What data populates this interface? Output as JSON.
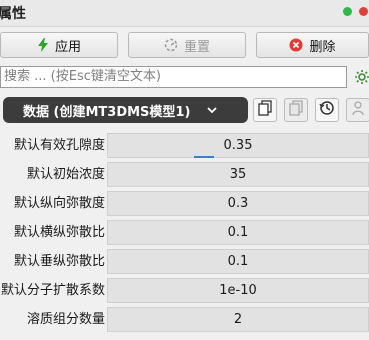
{
  "titlebar": {
    "title": "属性"
  },
  "actions": {
    "apply": "应用",
    "reset": "重置",
    "delete": "删除"
  },
  "search": {
    "placeholder": "搜索 ... (按Esc键清空文本)"
  },
  "dataset": {
    "selected": "数据 (创建MT3DMS模型1)"
  },
  "properties": [
    {
      "label": "默认有效孔隙度",
      "value": "0.35"
    },
    {
      "label": "默认初始浓度",
      "value": "35"
    },
    {
      "label": "默认纵向弥散度",
      "value": "0.3"
    },
    {
      "label": "默认横纵弥散比",
      "value": "0.1"
    },
    {
      "label": "默认垂纵弥散比",
      "value": "0.1"
    },
    {
      "label": "默认分子扩散系数",
      "value": "1e-10"
    },
    {
      "label": "溶质组分数量",
      "value": "2"
    }
  ],
  "colors": {
    "apply_icon": "#2aa52e",
    "delete_icon": "#e53935",
    "dropdown_bg": "#3c3c3c",
    "green_dot": "#2fb84a",
    "red_dot": "#e0403a"
  },
  "icons": [
    "bolt-icon",
    "reset-icon",
    "delete-icon",
    "gear-icon",
    "chevron-down-icon",
    "copy-icon",
    "paste-icon",
    "history-icon",
    "user-icon"
  ]
}
